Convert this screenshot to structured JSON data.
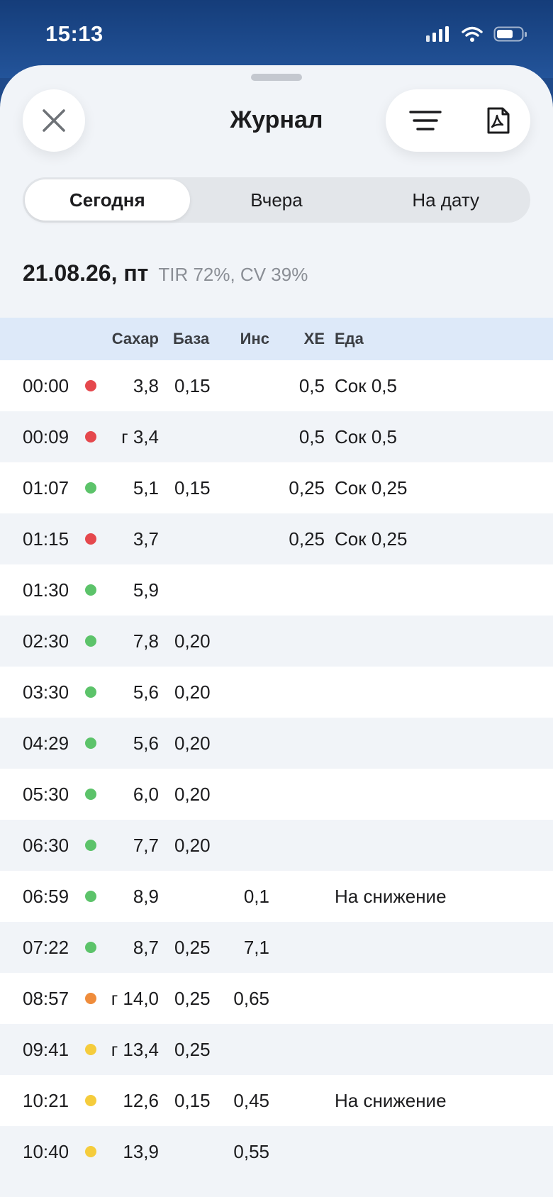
{
  "status": {
    "time": "15:13"
  },
  "header": {
    "title": "Журнал"
  },
  "tabs": [
    {
      "label": "Сегодня",
      "active": true
    },
    {
      "label": "Вчера",
      "active": false
    },
    {
      "label": "На дату",
      "active": false
    }
  ],
  "summary": {
    "date": "21.08.26, пт",
    "stats": "TIR 72%, CV 39%"
  },
  "columns": {
    "sugar": "Сахар",
    "base": "База",
    "ins": "Инс",
    "xe": "ХЕ",
    "food": "Еда"
  },
  "colors": {
    "red": "#e5484d",
    "green": "#5cc36a",
    "orange": "#ef8c3b",
    "yellow": "#f5cc3c"
  },
  "icons": {
    "close": "close-icon",
    "filter": "filter-lines-icon",
    "pdf": "pdf-document-icon"
  },
  "rows": [
    {
      "time": "00:00",
      "status": "red",
      "sugar": "3,8",
      "base": "0,15",
      "ins": "",
      "xe": "0,5",
      "food": "Сок 0,5"
    },
    {
      "time": "00:09",
      "status": "red",
      "sugar": "г 3,4",
      "base": "",
      "ins": "",
      "xe": "0,5",
      "food": "Сок 0,5"
    },
    {
      "time": "01:07",
      "status": "green",
      "sugar": "5,1",
      "base": "0,15",
      "ins": "",
      "xe": "0,25",
      "food": "Сок 0,25"
    },
    {
      "time": "01:15",
      "status": "red",
      "sugar": "3,7",
      "base": "",
      "ins": "",
      "xe": "0,25",
      "food": "Сок 0,25"
    },
    {
      "time": "01:30",
      "status": "green",
      "sugar": "5,9",
      "base": "",
      "ins": "",
      "xe": "",
      "food": ""
    },
    {
      "time": "02:30",
      "status": "green",
      "sugar": "7,8",
      "base": "0,20",
      "ins": "",
      "xe": "",
      "food": ""
    },
    {
      "time": "03:30",
      "status": "green",
      "sugar": "5,6",
      "base": "0,20",
      "ins": "",
      "xe": "",
      "food": ""
    },
    {
      "time": "04:29",
      "status": "green",
      "sugar": "5,6",
      "base": "0,20",
      "ins": "",
      "xe": "",
      "food": ""
    },
    {
      "time": "05:30",
      "status": "green",
      "sugar": "6,0",
      "base": "0,20",
      "ins": "",
      "xe": "",
      "food": ""
    },
    {
      "time": "06:30",
      "status": "green",
      "sugar": "7,7",
      "base": "0,20",
      "ins": "",
      "xe": "",
      "food": ""
    },
    {
      "time": "06:59",
      "status": "green",
      "sugar": "8,9",
      "base": "",
      "ins": "0,1",
      "xe": "",
      "food": "На снижение"
    },
    {
      "time": "07:22",
      "status": "green",
      "sugar": "8,7",
      "base": "0,25",
      "ins": "7,1",
      "xe": "",
      "food": ""
    },
    {
      "time": "08:57",
      "status": "orange",
      "sugar": "г 14,0",
      "base": "0,25",
      "ins": "0,65",
      "xe": "",
      "food": ""
    },
    {
      "time": "09:41",
      "status": "yellow",
      "sugar": "г 13,4",
      "base": "0,25",
      "ins": "",
      "xe": "",
      "food": ""
    },
    {
      "time": "10:21",
      "status": "yellow",
      "sugar": "12,6",
      "base": "0,15",
      "ins": "0,45",
      "xe": "",
      "food": "На снижение"
    },
    {
      "time": "10:40",
      "status": "yellow",
      "sugar": "13,9",
      "base": "",
      "ins": "0,55",
      "xe": "",
      "food": ""
    }
  ]
}
